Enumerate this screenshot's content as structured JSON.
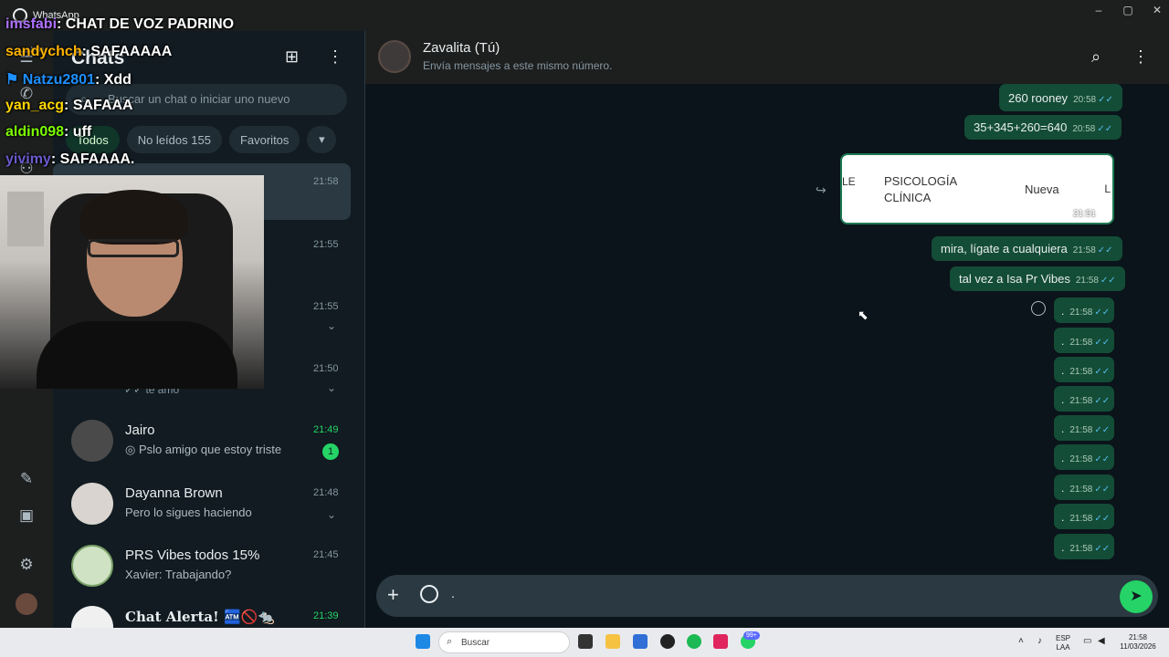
{
  "window": {
    "title": "WhatsApp",
    "controls": [
      "–",
      "▢",
      "✕"
    ]
  },
  "rail": {
    "mas_label": "Más"
  },
  "chatlist": {
    "title": "Chats",
    "search_placeholder": "Buscar un chat o iniciar uno nuevo",
    "filters": {
      "todos": "Todos",
      "no_leidos": "No leídos",
      "no_leidos_count": "155",
      "favoritos": "Favoritos"
    },
    "hidden_rows": [
      {
        "time": "21:58"
      },
      {
        "time": "21:55"
      },
      {
        "time": "21:55"
      },
      {
        "time": "21:50",
        "message": "te amo"
      }
    ],
    "rows": [
      {
        "name": "Jairo",
        "message": "Pslo amigo que estoy triste",
        "time": "21:49",
        "unread": "1"
      },
      {
        "name": "Dayanna Brown",
        "message": "Pero lo sigues haciendo",
        "time": "21:48"
      },
      {
        "name": "PRS Vibes todos 15%",
        "message": "Xavier: Trabajando?",
        "time": "21:45"
      },
      {
        "name": "Chat Alerta! 🏧🚫🐀",
        "message": "",
        "time": "21:39"
      }
    ]
  },
  "conversation": {
    "name": "Zavalita (Tú)",
    "subtitle": "Envía mensajes a este mismo número.",
    "messages": [
      {
        "text": "260 rooney",
        "time": "20:58"
      },
      {
        "text": "35+345+260=640",
        "time": "20:58"
      },
      {
        "text": "mira, lígate a cualquiera",
        "time": "21:58"
      },
      {
        "text": "tal vez a Isa Pr Vibes",
        "time": "21:58"
      }
    ],
    "image_card": {
      "left_edge": "LE",
      "title": "PSICOLOGÍA CLÍNICA",
      "right": "Nueva",
      "right_edge": "L",
      "time": "21:51"
    },
    "dot_messages": [
      {
        "text": ".",
        "time": "21:58"
      },
      {
        "text": ".",
        "time": "21:58"
      },
      {
        "text": ".",
        "time": "21:58"
      },
      {
        "text": ".",
        "time": "21:58"
      },
      {
        "text": ".",
        "time": "21:58"
      },
      {
        "text": ".",
        "time": "21:58"
      },
      {
        "text": ".",
        "time": "21:58"
      },
      {
        "text": ".",
        "time": "21:58"
      },
      {
        "text": ".",
        "time": "21:58"
      }
    ],
    "composer_value": "."
  },
  "stream_chat": [
    {
      "user": "imsfabi",
      "msg": ": CHAT DE VOZ PADRINO",
      "color": "#b072ff"
    },
    {
      "user": "sandychch",
      "msg": ": SAFAAAAA",
      "color": "#ffb300"
    },
    {
      "user": "Natzu2801",
      "msg": ": Xdd",
      "color": "#1e90ff"
    },
    {
      "user": "yan_acg",
      "msg": ": SAFAAA",
      "color": "#ffd700"
    },
    {
      "user": "aldin098",
      "msg": ": uff",
      "color": "#7cfc00"
    },
    {
      "user": "yivimy",
      "msg": ": SAFAAAA.",
      "color": "#6a5acd"
    }
  ],
  "taskbar": {
    "search": "Buscar",
    "lang": "ESP",
    "lang2": "LAA",
    "time": "21:58",
    "date": "11/03/2026",
    "badge": "99+"
  }
}
